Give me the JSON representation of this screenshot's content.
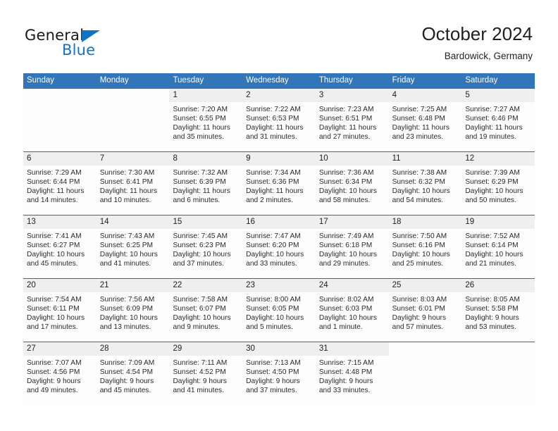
{
  "brand": {
    "name_part1": "General",
    "name_part2": "Blue",
    "logo_icon": "triangle-icon",
    "accent_color": "#1273c4"
  },
  "header": {
    "month_title": "October 2024",
    "location": "Bardowick, Germany"
  },
  "colors": {
    "header_band": "#3275b8",
    "week_rule": "#2b6ca8",
    "day_number_band": "#efefef",
    "page_background": "#ffffff"
  },
  "weekdays": [
    "Sunday",
    "Monday",
    "Tuesday",
    "Wednesday",
    "Thursday",
    "Friday",
    "Saturday"
  ],
  "calendar_data": {
    "type": "table",
    "title": "October 2024",
    "location": "Bardowick, Germany",
    "columns": [
      "Sunday",
      "Monday",
      "Tuesday",
      "Wednesday",
      "Thursday",
      "Friday",
      "Saturday"
    ],
    "weeks": [
      [
        {
          "day": "",
          "blank": true
        },
        {
          "day": "",
          "blank": true
        },
        {
          "day": "1",
          "sunrise": "Sunrise: 7:20 AM",
          "sunset": "Sunset: 6:55 PM",
          "daylight1": "Daylight: 11 hours",
          "daylight2": "and 35 minutes."
        },
        {
          "day": "2",
          "sunrise": "Sunrise: 7:22 AM",
          "sunset": "Sunset: 6:53 PM",
          "daylight1": "Daylight: 11 hours",
          "daylight2": "and 31 minutes."
        },
        {
          "day": "3",
          "sunrise": "Sunrise: 7:23 AM",
          "sunset": "Sunset: 6:51 PM",
          "daylight1": "Daylight: 11 hours",
          "daylight2": "and 27 minutes."
        },
        {
          "day": "4",
          "sunrise": "Sunrise: 7:25 AM",
          "sunset": "Sunset: 6:48 PM",
          "daylight1": "Daylight: 11 hours",
          "daylight2": "and 23 minutes."
        },
        {
          "day": "5",
          "sunrise": "Sunrise: 7:27 AM",
          "sunset": "Sunset: 6:46 PM",
          "daylight1": "Daylight: 11 hours",
          "daylight2": "and 19 minutes."
        }
      ],
      [
        {
          "day": "6",
          "sunrise": "Sunrise: 7:29 AM",
          "sunset": "Sunset: 6:44 PM",
          "daylight1": "Daylight: 11 hours",
          "daylight2": "and 14 minutes."
        },
        {
          "day": "7",
          "sunrise": "Sunrise: 7:30 AM",
          "sunset": "Sunset: 6:41 PM",
          "daylight1": "Daylight: 11 hours",
          "daylight2": "and 10 minutes."
        },
        {
          "day": "8",
          "sunrise": "Sunrise: 7:32 AM",
          "sunset": "Sunset: 6:39 PM",
          "daylight1": "Daylight: 11 hours",
          "daylight2": "and 6 minutes."
        },
        {
          "day": "9",
          "sunrise": "Sunrise: 7:34 AM",
          "sunset": "Sunset: 6:36 PM",
          "daylight1": "Daylight: 11 hours",
          "daylight2": "and 2 minutes."
        },
        {
          "day": "10",
          "sunrise": "Sunrise: 7:36 AM",
          "sunset": "Sunset: 6:34 PM",
          "daylight1": "Daylight: 10 hours",
          "daylight2": "and 58 minutes."
        },
        {
          "day": "11",
          "sunrise": "Sunrise: 7:38 AM",
          "sunset": "Sunset: 6:32 PM",
          "daylight1": "Daylight: 10 hours",
          "daylight2": "and 54 minutes."
        },
        {
          "day": "12",
          "sunrise": "Sunrise: 7:39 AM",
          "sunset": "Sunset: 6:29 PM",
          "daylight1": "Daylight: 10 hours",
          "daylight2": "and 50 minutes."
        }
      ],
      [
        {
          "day": "13",
          "sunrise": "Sunrise: 7:41 AM",
          "sunset": "Sunset: 6:27 PM",
          "daylight1": "Daylight: 10 hours",
          "daylight2": "and 45 minutes."
        },
        {
          "day": "14",
          "sunrise": "Sunrise: 7:43 AM",
          "sunset": "Sunset: 6:25 PM",
          "daylight1": "Daylight: 10 hours",
          "daylight2": "and 41 minutes."
        },
        {
          "day": "15",
          "sunrise": "Sunrise: 7:45 AM",
          "sunset": "Sunset: 6:23 PM",
          "daylight1": "Daylight: 10 hours",
          "daylight2": "and 37 minutes."
        },
        {
          "day": "16",
          "sunrise": "Sunrise: 7:47 AM",
          "sunset": "Sunset: 6:20 PM",
          "daylight1": "Daylight: 10 hours",
          "daylight2": "and 33 minutes."
        },
        {
          "day": "17",
          "sunrise": "Sunrise: 7:49 AM",
          "sunset": "Sunset: 6:18 PM",
          "daylight1": "Daylight: 10 hours",
          "daylight2": "and 29 minutes."
        },
        {
          "day": "18",
          "sunrise": "Sunrise: 7:50 AM",
          "sunset": "Sunset: 6:16 PM",
          "daylight1": "Daylight: 10 hours",
          "daylight2": "and 25 minutes."
        },
        {
          "day": "19",
          "sunrise": "Sunrise: 7:52 AM",
          "sunset": "Sunset: 6:14 PM",
          "daylight1": "Daylight: 10 hours",
          "daylight2": "and 21 minutes."
        }
      ],
      [
        {
          "day": "20",
          "sunrise": "Sunrise: 7:54 AM",
          "sunset": "Sunset: 6:11 PM",
          "daylight1": "Daylight: 10 hours",
          "daylight2": "and 17 minutes."
        },
        {
          "day": "21",
          "sunrise": "Sunrise: 7:56 AM",
          "sunset": "Sunset: 6:09 PM",
          "daylight1": "Daylight: 10 hours",
          "daylight2": "and 13 minutes."
        },
        {
          "day": "22",
          "sunrise": "Sunrise: 7:58 AM",
          "sunset": "Sunset: 6:07 PM",
          "daylight1": "Daylight: 10 hours",
          "daylight2": "and 9 minutes."
        },
        {
          "day": "23",
          "sunrise": "Sunrise: 8:00 AM",
          "sunset": "Sunset: 6:05 PM",
          "daylight1": "Daylight: 10 hours",
          "daylight2": "and 5 minutes."
        },
        {
          "day": "24",
          "sunrise": "Sunrise: 8:02 AM",
          "sunset": "Sunset: 6:03 PM",
          "daylight1": "Daylight: 10 hours",
          "daylight2": "and 1 minute."
        },
        {
          "day": "25",
          "sunrise": "Sunrise: 8:03 AM",
          "sunset": "Sunset: 6:01 PM",
          "daylight1": "Daylight: 9 hours",
          "daylight2": "and 57 minutes."
        },
        {
          "day": "26",
          "sunrise": "Sunrise: 8:05 AM",
          "sunset": "Sunset: 5:58 PM",
          "daylight1": "Daylight: 9 hours",
          "daylight2": "and 53 minutes."
        }
      ],
      [
        {
          "day": "27",
          "sunrise": "Sunrise: 7:07 AM",
          "sunset": "Sunset: 4:56 PM",
          "daylight1": "Daylight: 9 hours",
          "daylight2": "and 49 minutes."
        },
        {
          "day": "28",
          "sunrise": "Sunrise: 7:09 AM",
          "sunset": "Sunset: 4:54 PM",
          "daylight1": "Daylight: 9 hours",
          "daylight2": "and 45 minutes."
        },
        {
          "day": "29",
          "sunrise": "Sunrise: 7:11 AM",
          "sunset": "Sunset: 4:52 PM",
          "daylight1": "Daylight: 9 hours",
          "daylight2": "and 41 minutes."
        },
        {
          "day": "30",
          "sunrise": "Sunrise: 7:13 AM",
          "sunset": "Sunset: 4:50 PM",
          "daylight1": "Daylight: 9 hours",
          "daylight2": "and 37 minutes."
        },
        {
          "day": "31",
          "sunrise": "Sunrise: 7:15 AM",
          "sunset": "Sunset: 4:48 PM",
          "daylight1": "Daylight: 9 hours",
          "daylight2": "and 33 minutes."
        },
        {
          "day": "",
          "blank": true
        },
        {
          "day": "",
          "blank": true
        }
      ]
    ]
  }
}
